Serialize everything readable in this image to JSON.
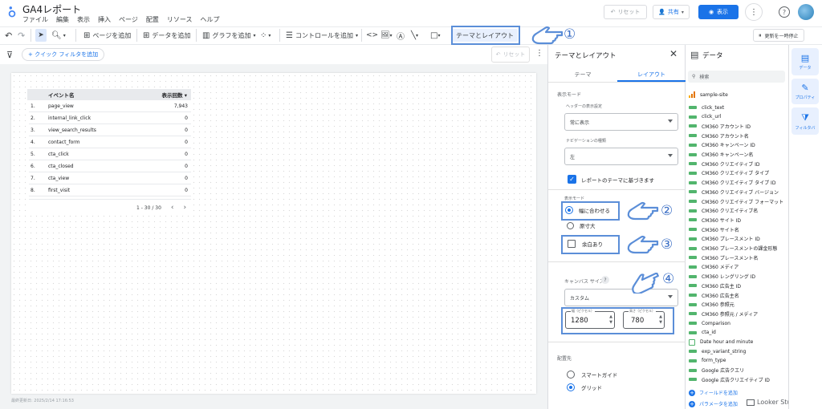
{
  "app": {
    "title": "GA4レポート",
    "menus": [
      "ファイル",
      "編集",
      "表示",
      "挿入",
      "ページ",
      "配置",
      "リソース",
      "ヘルプ"
    ],
    "reset_label": "リセット",
    "share_label": "共有",
    "view_label": "表示",
    "pause_label": "更新を一時停止"
  },
  "toolbar": {
    "add_page": "ページを追加",
    "add_data": "データを追加",
    "add_chart": "グラフを追加",
    "add_control": "コントロールを追加",
    "theme_layout": "テーマとレイアウト"
  },
  "filterbar": {
    "quick_filter": "+ クイック フィルタを追加",
    "reset": "リセット"
  },
  "canvas": {
    "table": {
      "header_event": "イベント名",
      "header_views": "表示回数 ▾",
      "rows": [
        {
          "n": "1.",
          "event": "page_view",
          "value": "7,943"
        },
        {
          "n": "2.",
          "event": "internal_link_click",
          "value": "0"
        },
        {
          "n": "3.",
          "event": "view_search_results",
          "value": "0"
        },
        {
          "n": "4.",
          "event": "contact_form",
          "value": "0"
        },
        {
          "n": "5.",
          "event": "cta_click",
          "value": "0"
        },
        {
          "n": "6.",
          "event": "cta_closed",
          "value": "0"
        },
        {
          "n": "7.",
          "event": "cta_view",
          "value": "0"
        },
        {
          "n": "8.",
          "event": "first_visit",
          "value": "0"
        }
      ],
      "pagination": "1 - 30 / 30"
    },
    "last_updated": "最終更新日: 2025/2/14 17:16:53"
  },
  "theme_panel": {
    "title": "テーマとレイアウト",
    "tab_theme": "テーマ",
    "tab_layout": "レイアウト",
    "display_mode_section": "表示モード",
    "header_display_label": "ヘッダーの表示設定",
    "header_display_value": "常に表示",
    "nav_type_label": "ナビゲーションの種類",
    "nav_type_value": "左",
    "theme_based_label": "レポートのテーマに基づきます",
    "display_mode_label": "表示モード",
    "fit_width_label": "幅に合わせる",
    "actual_size_label": "原寸大",
    "margin_label": "余白あり",
    "canvas_size_label": "キャンバス サイズ",
    "canvas_size_value": "カスタム",
    "width_label": "幅（ピクセル）",
    "width_value": "1280",
    "height_label": "高さ（ピクセル）",
    "height_value": "780",
    "placement_label": "配置先",
    "smart_guide_label": "スマートガイド",
    "grid_label": "グリッド"
  },
  "data_panel": {
    "title": "データ",
    "search_placeholder": "検索",
    "source": "sample-site",
    "fields": [
      "click_text",
      "click_url",
      "CM360 アカウント ID",
      "CM360 アカウント名",
      "CM360 キャンペーン ID",
      "CM360 キャンペーン名",
      "CM360 クリエイティブ ID",
      "CM360 クリエイティブ タイプ",
      "CM360 クリエイティブ タイプ ID",
      "CM360 クリエイティブ バージョン",
      "CM360 クリエイティブ フォーマット",
      "CM360 クリエイティブ名",
      "CM360 サイト ID",
      "CM360 サイト名",
      "CM360 プレースメント ID",
      "CM360 プレースメントの課金形態",
      "CM360 プレースメント名",
      "CM360 メディア",
      "CM360 レングリング ID",
      "CM360 広告主 ID",
      "CM360 広告主名",
      "CM360 参照元",
      "CM360 参照元 / メディア",
      "Comparison",
      "cta_id",
      "Date hour and minute",
      "exp_variant_string",
      "form_type",
      "Google 広告クエリ",
      "Google 広告クリエイティブ ID"
    ],
    "add_field": "フィールドを追加",
    "add_param": "パラメータを追加",
    "watermark": "Looker Studio Guide"
  },
  "side_tabs": {
    "data": "データ",
    "properties": "プロパティ",
    "filter": "フィルタバ"
  },
  "annotations": [
    "①",
    "②",
    "③",
    "④"
  ],
  "colors": {
    "accent": "#1a73e8",
    "annotation_blue": "#5b8ed8",
    "field_green": "#34a853"
  }
}
